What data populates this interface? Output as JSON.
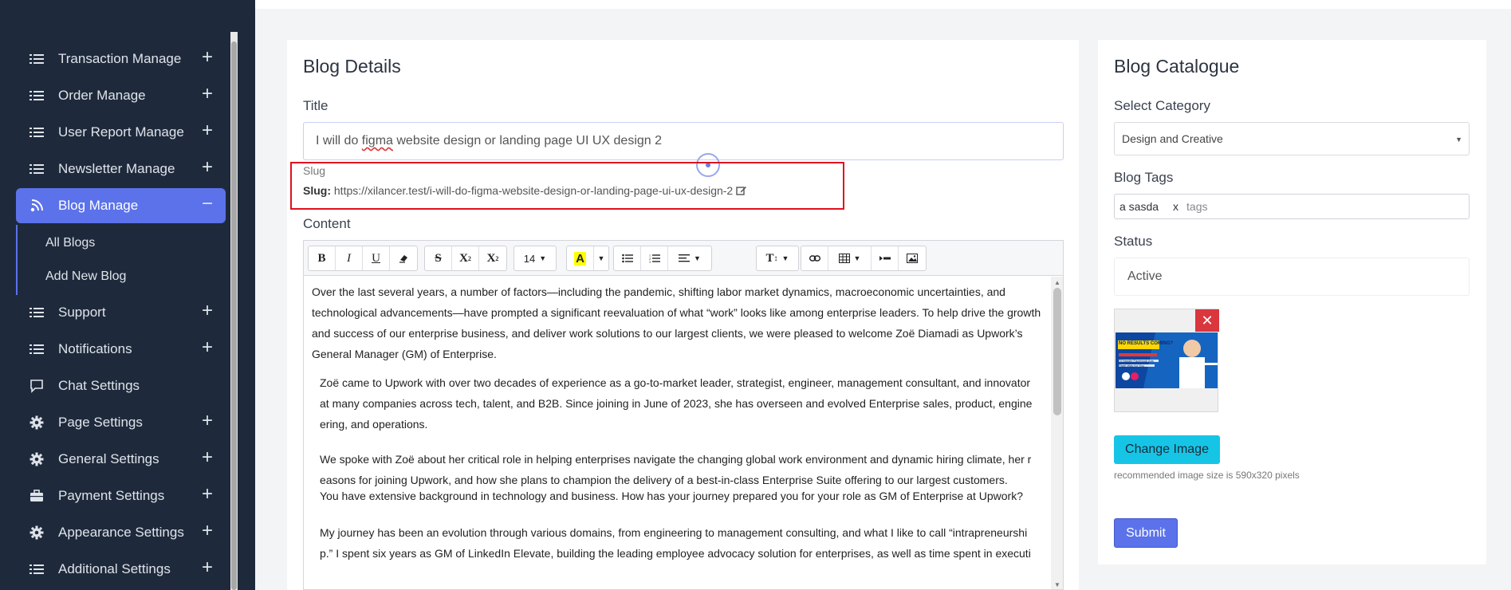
{
  "sidebar": {
    "items": [
      {
        "label": "Transaction Manage",
        "icon": "list-icon"
      },
      {
        "label": "Order Manage",
        "icon": "list-icon"
      },
      {
        "label": "User Report Manage",
        "icon": "list-icon"
      },
      {
        "label": "Newsletter Manage",
        "icon": "list-icon"
      },
      {
        "label": "Blog Manage",
        "icon": "blog-icon"
      },
      {
        "label": "Support",
        "icon": "list-icon"
      },
      {
        "label": "Notifications",
        "icon": "list-icon"
      },
      {
        "label": "Chat Settings",
        "icon": "chat-icon"
      },
      {
        "label": "Page Settings",
        "icon": "gear-icon"
      },
      {
        "label": "General Settings",
        "icon": "gear-icon"
      },
      {
        "label": "Payment Settings",
        "icon": "briefcase-icon"
      },
      {
        "label": "Appearance Settings",
        "icon": "gear-icon"
      },
      {
        "label": "Additional Settings",
        "icon": "list-icon"
      }
    ],
    "sub_items": [
      "All Blogs",
      "Add New Blog"
    ],
    "expanded": "Blog Manage",
    "accent": "#5b72ea",
    "bg": "#1e2a3b"
  },
  "blog_details": {
    "heading": "Blog Details",
    "title_label": "Title",
    "title_value_pre": "I will do ",
    "title_value_misspelled": "figma",
    "title_value_post": " website design or landing page UI UX design 2",
    "slug_label": "Slug",
    "slug_prefix": "Slug:",
    "slug_url": "https://xilancer.test/i-will-do-figma-website-design-or-landing-page-ui-ux-design-2",
    "content_label": "Content"
  },
  "editor": {
    "font_size": "14",
    "paragraphs": [
      [
        "Over the last several years, a number of factors—including the pandemic, shifting labor market dynamics, macroeconomic uncertainties, and",
        "technological advancements—have prompted a significant reevaluation of what “work” looks like among enterprise leaders. To help drive the growth",
        "and success of our enterprise business, and deliver work solutions to our largest clients, we were pleased to welcome Zoë Diamadi as Upwork’s",
        "General Manager (GM) of Enterprise."
      ],
      [
        "Zoë came to Upwork with over two decades of experience as a go-to-market leader, strategist, engineer, management consultant, and innovator",
        "at many companies across tech, talent, and B2B. Since joining in June of 2023, she has overseen and evolved Enterprise sales, product, engine",
        "ering, and operations."
      ],
      [
        "We spoke with Zoë about her critical role in helping enterprises navigate the changing global work environment and dynamic hiring climate, her r",
        "easons for joining Upwork, and how she plans to champion the delivery of a best-in-class Enterprise Suite offering to our largest customers."
      ],
      [
        "You have extensive background in technology and business. How has your journey prepared you for your role as GM of Enterprise at Upwork?"
      ],
      [
        "My journey has been an evolution through various domains, from engineering to management consulting, and what I like to call “intrapreneurshi",
        "p.” I spent six years as GM of LinkedIn Elevate, building the leading employee advocacy solution for enterprises, as well as time spent in executi"
      ]
    ]
  },
  "blog_catalogue": {
    "heading": "Blog Catalogue",
    "category_label": "Select Category",
    "category_value": "Design and Creative",
    "tags_label": "Blog Tags",
    "tag_chip": "a sasda",
    "tag_remove": "x",
    "tags_placeholder": "tags",
    "status_label": "Status",
    "status_value": "Active",
    "thumbnail": {
      "text_no_results": "NO RESULTS COMING?",
      "text_fix": "I'll Handle Facebook Ads Right Way for You"
    },
    "change_image_label": "Change Image",
    "image_hint": "recommended image size is 590x320 pixels",
    "submit_label": "Submit"
  }
}
